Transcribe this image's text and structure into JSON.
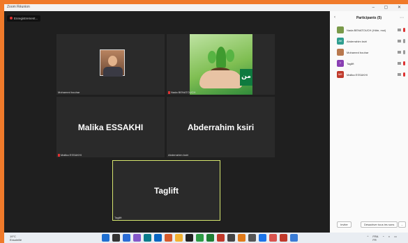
{
  "window": {
    "title": "Zoom Réunion"
  },
  "recording": {
    "label": "Enregistrement..."
  },
  "tiles": [
    {
      "id": "mohamed",
      "name": "Mohamed bouhar"
    },
    {
      "id": "nada",
      "name": "Nada BENATOUCH",
      "overlay_text": "من"
    },
    {
      "id": "malika",
      "name": "Malika ESSAKHI",
      "big_label": "Malika ESSAKHI"
    },
    {
      "id": "abderrahim",
      "name": "Abderrahim ksiri",
      "big_label": "Abderrahim ksiri"
    },
    {
      "id": "taglift",
      "name": "Taglift",
      "big_label": "Taglift"
    }
  ],
  "participants_panel": {
    "title": "Participants (5)",
    "items": [
      {
        "name": "Nada BENATOUCH (Hôte, moi)",
        "initials": "",
        "color": "#7a9a4a",
        "mic": "off"
      },
      {
        "name": "Abderrahim ksiri",
        "initials": "AK",
        "color": "#2e9e8f",
        "mic": "on"
      },
      {
        "name": "Mohamed bouhar",
        "initials": "",
        "color": "#b8784e",
        "mic": "on"
      },
      {
        "name": "Taglift",
        "initials": "T",
        "color": "#8a3fb3",
        "mic": "off"
      },
      {
        "name": "Malika ESSAKHI",
        "initials": "ME",
        "color": "#c0392b",
        "mic": "off"
      }
    ],
    "buttons": {
      "invite": "Inviter",
      "mute_all": "Désactiver tous les sons",
      "more": "..."
    }
  },
  "taskbar": {
    "weather_temp": "19°C",
    "weather_desc": "Ensoleillé",
    "lang": "FRA\nFR",
    "time": "",
    "icon_colors": [
      "#1f6fd1",
      "#333",
      "#2b6cd6",
      "#8458c9",
      "#0a7c8c",
      "#0a66c2",
      "#d65a2b",
      "#f2b233",
      "#222",
      "#2d9a45",
      "#1e7e34",
      "#c0392b",
      "#444",
      "#e07a1a",
      "#555",
      "#1a73e8",
      "#d9534f",
      "#c0392b",
      "#3a7bd5"
    ]
  }
}
